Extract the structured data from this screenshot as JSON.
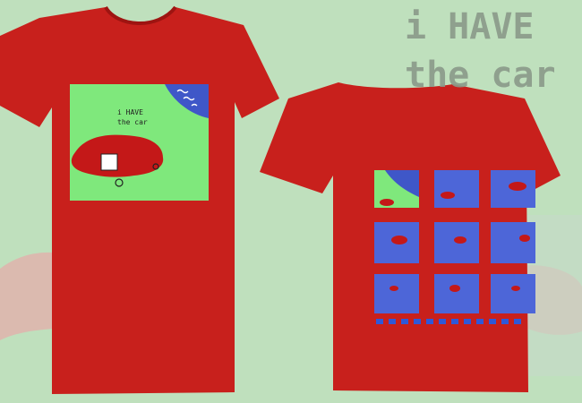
{
  "background_caption": {
    "line1": "i HAVE",
    "line2": "the car"
  },
  "front_print": {
    "line1": "i HAVE",
    "line2": "the car"
  },
  "colors": {
    "background": "#bfe0bd",
    "shirt": "#c8201c",
    "grass": "#7fe87c",
    "water": "#3f57c8",
    "car": "#c41818"
  },
  "back_print": {
    "panel_rows": 3,
    "panel_cols": 3,
    "dots": 12
  }
}
